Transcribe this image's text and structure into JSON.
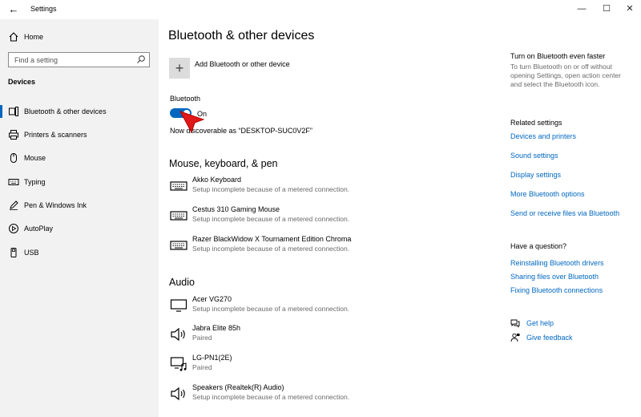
{
  "window": {
    "title": "Settings",
    "back": "←",
    "minimize": "—",
    "maximize": "☐",
    "close": "✕"
  },
  "sidebar": {
    "home_label": "Home",
    "search_placeholder": "Find a setting",
    "section": "Devices",
    "items": [
      {
        "label": "Bluetooth & other devices",
        "icon": "bluetooth-icon"
      },
      {
        "label": "Printers & scanners",
        "icon": "printer-icon"
      },
      {
        "label": "Mouse",
        "icon": "mouse-icon"
      },
      {
        "label": "Typing",
        "icon": "keyboard-icon"
      },
      {
        "label": "Pen & Windows Ink",
        "icon": "pen-icon"
      },
      {
        "label": "AutoPlay",
        "icon": "autoplay-icon"
      },
      {
        "label": "USB",
        "icon": "usb-icon"
      }
    ],
    "selected_index": 0
  },
  "main": {
    "title": "Bluetooth & other devices",
    "add_device_label": "Add Bluetooth or other device",
    "bluetooth_label": "Bluetooth",
    "bluetooth_state": "On",
    "discoverable_text": "Now discoverable as “DESKTOP-SUC0V2F”",
    "groups": [
      {
        "title": "Mouse, keyboard, & pen",
        "devices": [
          {
            "name": "Akko Keyboard",
            "status": "Setup incomplete because of a metered connection.",
            "icon": "keyboard-icon"
          },
          {
            "name": "Cestus 310 Gaming Mouse",
            "status": "Setup incomplete because of a metered connection.",
            "icon": "keyboard-icon"
          },
          {
            "name": "Razer BlackWidow X Tournament Edition Chroma",
            "status": "Setup incomplete because of a metered connection.",
            "icon": "keyboard-icon"
          }
        ]
      },
      {
        "title": "Audio",
        "devices": [
          {
            "name": "Acer VG270",
            "status": "Setup incomplete because of a metered connection.",
            "icon": "monitor-icon"
          },
          {
            "name": "Jabra Elite 85h",
            "status": "Paired",
            "icon": "speaker-icon"
          },
          {
            "name": "LG-PN1(2E)",
            "status": "Paired",
            "icon": "display-audio-icon"
          },
          {
            "name": "Speakers (Realtek(R) Audio)",
            "status": "Setup incomplete because of a metered connection.",
            "icon": "speaker-icon"
          }
        ]
      }
    ]
  },
  "right_panel": {
    "tip_heading": "Turn on Bluetooth even faster",
    "tip_text": "To turn Bluetooth on or off without opening Settings, open action center and select the Bluetooth icon.",
    "related_heading": "Related settings",
    "related_links": [
      "Devices and printers",
      "Sound settings",
      "Display settings",
      "More Bluetooth options",
      "Send or receive files via Bluetooth"
    ],
    "question_heading": "Have a question?",
    "question_links": [
      "Reinstalling Bluetooth drivers",
      "Sharing files over Bluetooth",
      "Fixing Bluetooth connections"
    ],
    "get_help": "Get help",
    "give_feedback": "Give feedback"
  },
  "colors": {
    "accent": "#0067c0",
    "sidebar_bg": "#f2f2f2",
    "secondary_text": "#6a6a6a"
  }
}
